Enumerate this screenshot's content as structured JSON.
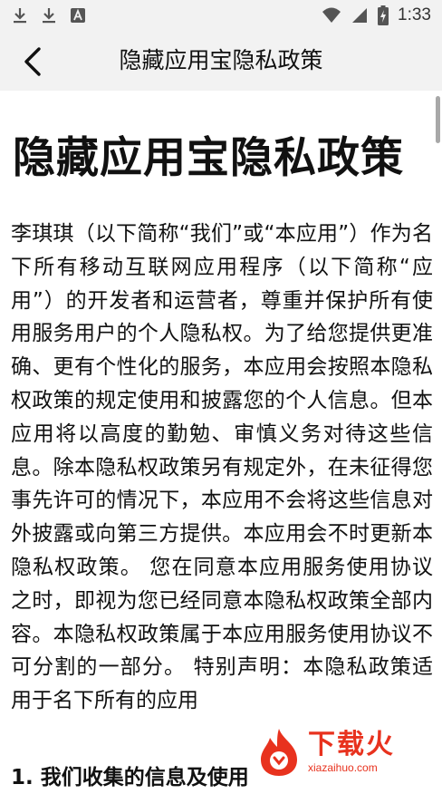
{
  "status_bar": {
    "time": "1:33",
    "icons": [
      "download-icon",
      "download-icon",
      "notification-a-icon",
      "wifi-icon",
      "signal-icon",
      "battery-charging-icon"
    ]
  },
  "app_bar": {
    "title": "隐藏应用宝隐私政策",
    "back_icon": "chevron-left-icon"
  },
  "document": {
    "title": "隐藏应用宝隐私政策",
    "body": "李琪琪（以下简称“我们”或“本应用”）作为名下所有移动互联网应用程序（以下简称“应用”）的开发者和运营者，尊重并保护所有使用服务用户的个人隐私权。为了给您提供更准确、更有个性化的服务，本应用会按照本隐私权政策的规定使用和披露您的个人信息。但本应用将以高度的勤勉、审慎义务对待这些信息。除本隐私权政策另有规定外，在未征得您事先许可的情况下，本应用不会将这些信息对外披露或向第三方提供。本应用会不时更新本隐私权政策。 您在同意本应用服务使用协议之时，即视为您已经同意本隐私权政策全部内容。本隐私权政策属于本应用服务使用协议不可分割的一部分。 特别声明：本隐私政策适用于名下所有的应用",
    "section_1": "1. 我们收集的信息及使用"
  },
  "watermark": {
    "brand": "下载火",
    "url": "xiazaihuo.com"
  },
  "colors": {
    "bar_background": "#f2f2f2",
    "text": "#111111",
    "watermark": "#e8321e"
  }
}
